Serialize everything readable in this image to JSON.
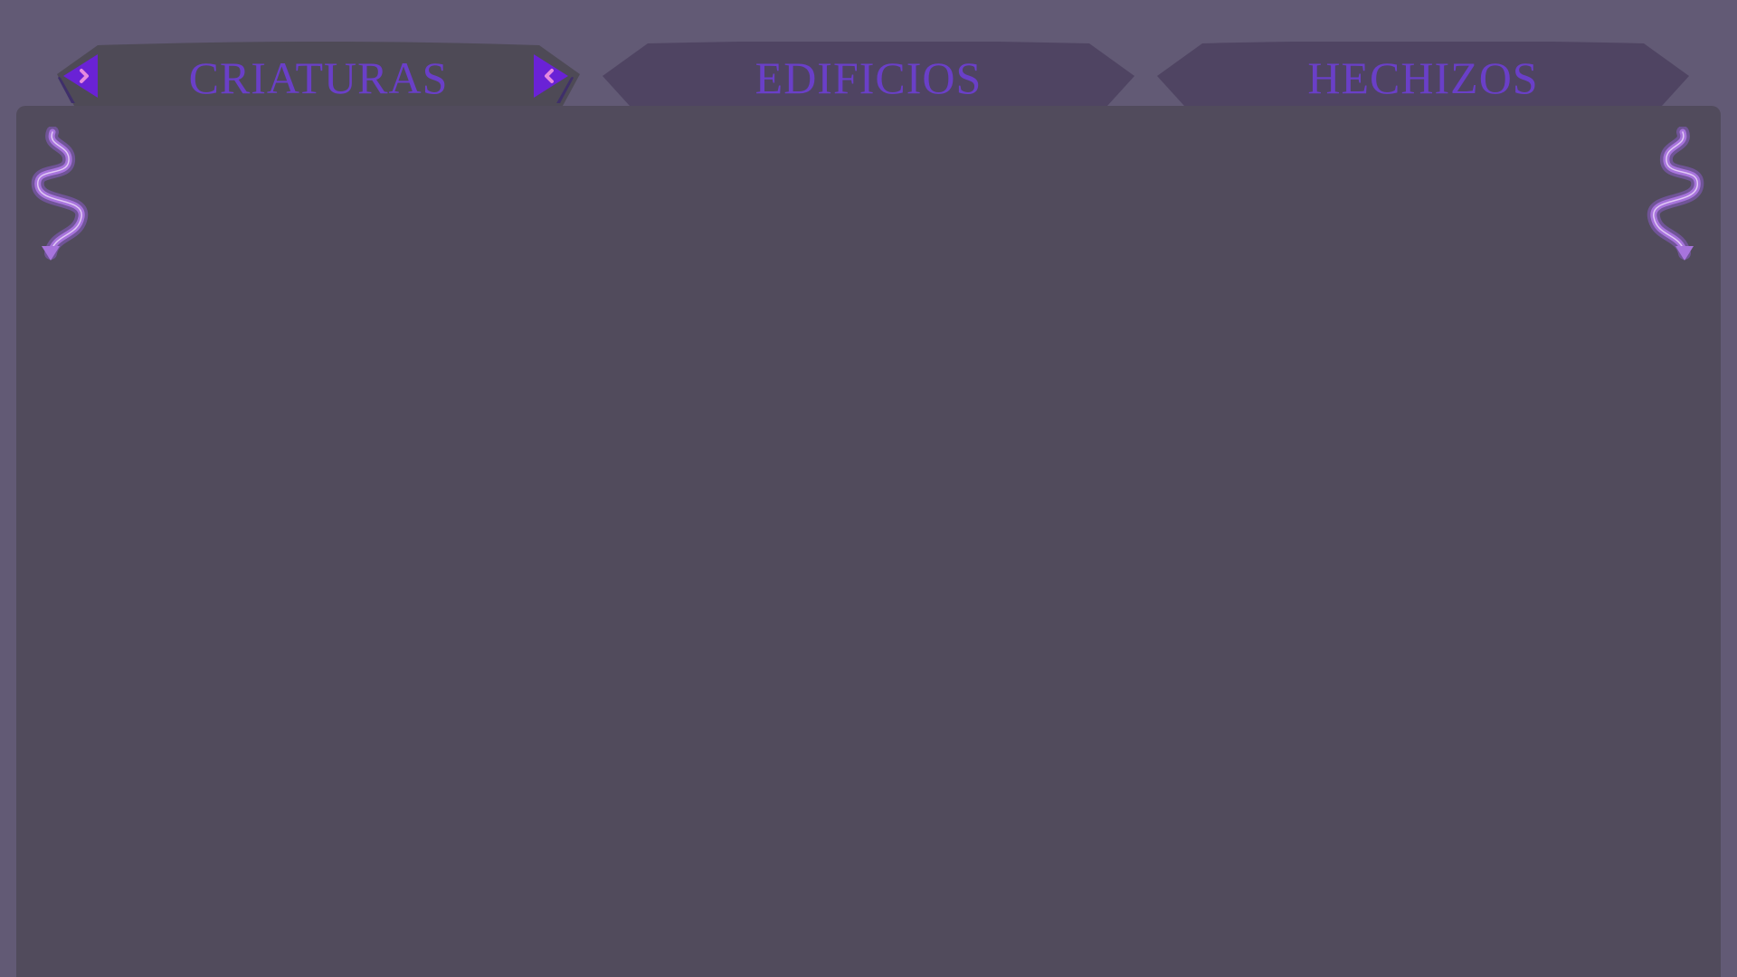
{
  "theme": {
    "background": "#625a75",
    "panel": "#514b5c",
    "tab_active": "#4e4a56",
    "tab_inactive": "#4f4462",
    "tab_text": "#6a3fc8",
    "arrow_fill": "#6a22d6",
    "arrow_glyph": "#e58adf",
    "flourish": "#a774dc"
  },
  "tabs": [
    {
      "label": "CRIATURAS",
      "active": true
    },
    {
      "label": "EDIFICIOS",
      "active": false
    },
    {
      "label": "HECHIZOS",
      "active": false
    }
  ],
  "arrows": {
    "prev_icon": "chevron-right-icon",
    "next_icon": "chevron-left-icon"
  },
  "decorations": {
    "left_icon": "swirl-flourish-icon",
    "right_icon": "swirl-flourish-icon"
  }
}
